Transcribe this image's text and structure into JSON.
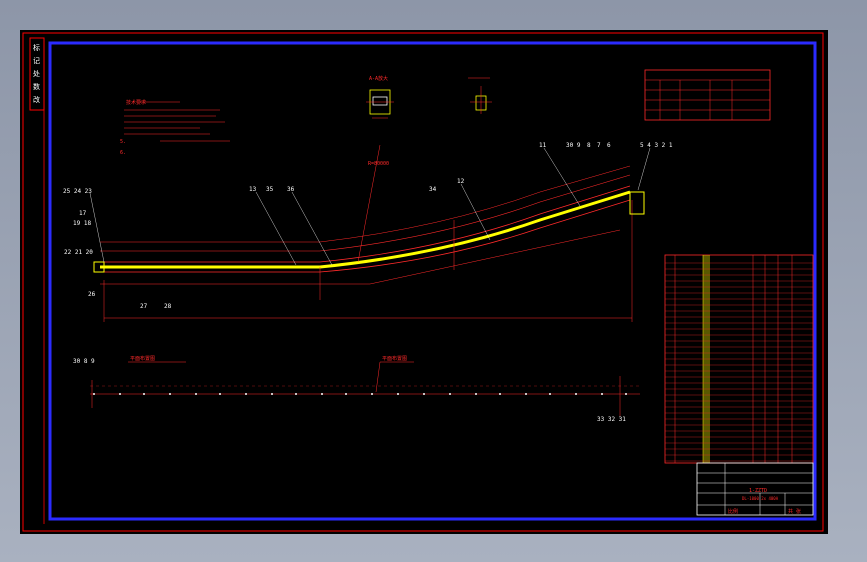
{
  "drawing": {
    "side_labels": [
      "标",
      "记",
      "处",
      "数",
      "改"
    ],
    "callouts": {
      "c_252423": "25 24 23",
      "c_17": "17",
      "c_1918": "19 18",
      "c_222120": "22 21 20",
      "c_26": "26",
      "c_27": "27",
      "c_28": "28",
      "c_13": "13",
      "c_35": "35",
      "c_36": "36",
      "c_34": "34",
      "c_12": "12",
      "c_11": "11",
      "c_3098": "30 9",
      "c_8": "8",
      "c_7": "7",
      "c_6": "6",
      "c_54321": "5 4 3 2 1",
      "c_3089": "30 8 9",
      "c_333231": "33 32 31"
    },
    "section_label_1": "平面布置图",
    "section_label_2": "平面布置图",
    "radius_label": "R=80000",
    "detail_label": "A-A放大",
    "notes_title": "技术要求",
    "notes": [
      "1.",
      "2.",
      "3.",
      "4.",
      "5.",
      "6."
    ]
  },
  "title_block": {
    "drawing_no": "1-ZZTD",
    "subtitle": "DL-1000 2x 400A",
    "scale_label": "比例",
    "sheet_label": "共 张"
  },
  "colors": {
    "background": "#000000",
    "border_red": "#ff0000",
    "frame_blue": "#2b2bff",
    "conveyor": "#ffff00",
    "text": "#ff2a2a",
    "white": "#ffffff"
  }
}
